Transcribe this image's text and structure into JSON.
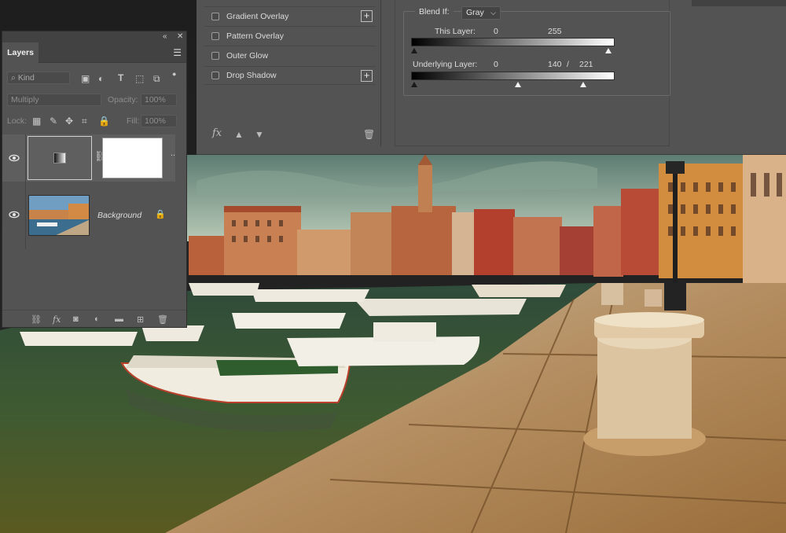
{
  "layer_style_dialog": {
    "effects": [
      {
        "label": "Gradient Overlay",
        "has_add": true
      },
      {
        "label": "Pattern Overlay",
        "has_add": false
      },
      {
        "label": "Outer Glow",
        "has_add": false
      },
      {
        "label": "Drop Shadow",
        "has_add": true
      }
    ],
    "footer_icons": [
      "fx-icon",
      "move-up-icon",
      "move-down-icon",
      "trash-icon"
    ],
    "fx_label": "fx",
    "blend_if": {
      "label": "Blend If:",
      "channel": "Gray",
      "this_layer": {
        "label": "This Layer:",
        "low": "0",
        "high": "255"
      },
      "underlying_layer": {
        "label": "Underlying Layer:",
        "low": "0",
        "high_split_a": "140",
        "separator": "/",
        "high_split_b": "221"
      }
    }
  },
  "layers_panel": {
    "tab": "Layers",
    "filter": {
      "placeholder": "Kind",
      "icons": [
        "search-icon",
        "image-filter-icon",
        "adjustment-filter-icon",
        "type-filter-icon",
        "shape-filter-icon",
        "smart-object-filter-icon"
      ]
    },
    "blend_mode": "Multiply",
    "opacity": {
      "label": "Opacity:",
      "value": "100%"
    },
    "lock": {
      "label": "Lock:"
    },
    "fill": {
      "label": "Fill:",
      "value": "100%"
    },
    "layers": [
      {
        "name": "",
        "type": "gradient-fill",
        "visible": true,
        "selected": true
      },
      {
        "name": "Background",
        "type": "image",
        "visible": true,
        "locked": true
      }
    ],
    "footer_icons": [
      "link-icon",
      "fx-icon",
      "mask-icon",
      "adjustment-icon",
      "folder-icon",
      "new-layer-icon",
      "trash-icon"
    ]
  },
  "colors": {
    "panel_bg": "#535353",
    "panel_dark": "#424242",
    "selected_layer": "#5e5e5e"
  }
}
